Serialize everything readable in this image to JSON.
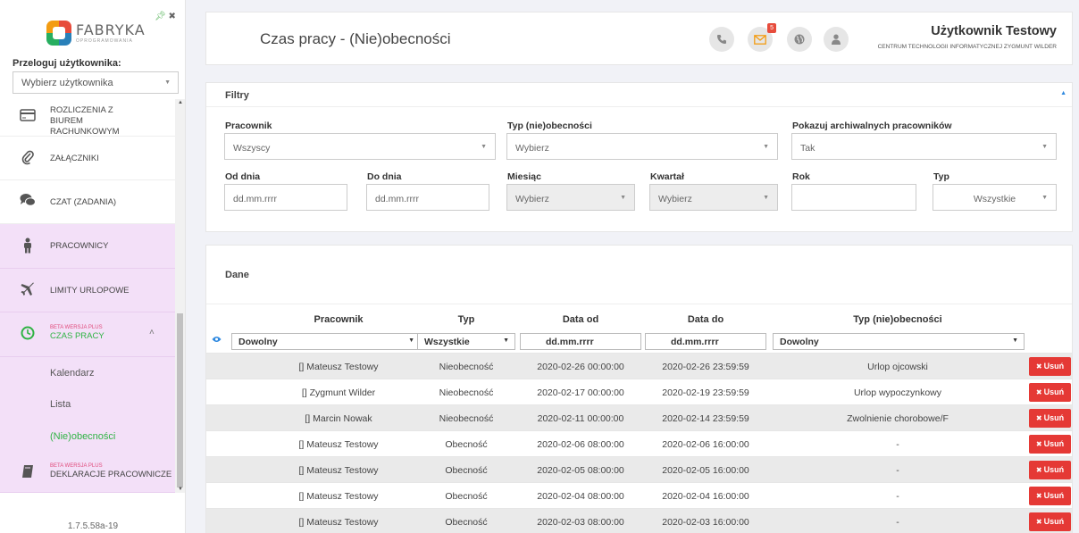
{
  "sidebar": {
    "logo_text": "FABRYKA",
    "logo_sub": "OPROGRAMOWANIA",
    "impersonate_label": "Przeloguj użytkownika:",
    "impersonate_placeholder": "Wybierz użytkownika",
    "menu": [
      {
        "label": "ROZLICZENIA Z BIUREM RACHUNKOWYM",
        "icon": "credit-card-icon"
      },
      {
        "label": "ZAŁĄCZNIKI",
        "icon": "paperclip-icon"
      },
      {
        "label": "CZAT (ZADANIA)",
        "icon": "chat-icon"
      },
      {
        "label": "PRACOWNICY",
        "icon": "person-icon"
      },
      {
        "label": "LIMITY URLOPOWE",
        "icon": "plane-icon"
      },
      {
        "label": "CZAS PRACY",
        "beta": "BETA WERSJA PLUS",
        "icon": "clock-icon"
      },
      {
        "label": "DEKLARACJE PRACOWNICZE",
        "beta": "BETA WERSJA PLUS",
        "icon": "book-icon"
      }
    ],
    "submenu": [
      "Kalendarz",
      "Lista",
      "(Nie)obecności"
    ],
    "version": "1.7.5.58a-19"
  },
  "header": {
    "title": "Czas pracy - (Nie)obecności",
    "mail_count": "5",
    "user_name": "Użytkownik Testowy",
    "user_org": "CENTRUM TECHNOLOGII INFORMATYCZNEJ ZYGMUNT WILDER"
  },
  "filters": {
    "title": "Filtry",
    "pracownik_label": "Pracownik",
    "pracownik_value": "Wszyscy",
    "typ_label": "Typ (nie)obecności",
    "typ_value": "Wybierz",
    "archiwalni_label": "Pokazuj archiwalnych pracowników",
    "archiwalni_value": "Tak",
    "od_label": "Od dnia",
    "od_placeholder": "dd.mm.rrrr",
    "do_label": "Do dnia",
    "do_placeholder": "dd.mm.rrrr",
    "miesiac_label": "Miesiąc",
    "miesiac_value": "Wybierz",
    "kwartal_label": "Kwartał",
    "kwartal_value": "Wybierz",
    "rok_label": "Rok",
    "rok_value": "",
    "typ2_label": "Typ",
    "typ2_value": "Wszystkie"
  },
  "data": {
    "title": "Dane",
    "columns": [
      "Pracownik",
      "Typ",
      "Data od",
      "Data do",
      "Typ (nie)obecności"
    ],
    "column_filters": {
      "pracownik": "Dowolny",
      "typ": "Wszystkie",
      "data_od": "dd.mm.rrrr",
      "data_do": "dd.mm.rrrr",
      "typ_nieobecnosci": "Dowolny"
    },
    "delete_label": "Usuń",
    "rows": [
      {
        "pracownik": "[] Mateusz Testowy",
        "typ": "Nieobecność",
        "od": "2020-02-26 00:00:00",
        "do": "2020-02-26 23:59:59",
        "rodzaj": "Urlop ojcowski"
      },
      {
        "pracownik": "[] Zygmunt Wilder",
        "typ": "Nieobecność",
        "od": "2020-02-17 00:00:00",
        "do": "2020-02-19 23:59:59",
        "rodzaj": "Urlop wypoczynkowy"
      },
      {
        "pracownik": "[] Marcin Nowak",
        "typ": "Nieobecność",
        "od": "2020-02-11 00:00:00",
        "do": "2020-02-14 23:59:59",
        "rodzaj": "Zwolnienie chorobowe/F"
      },
      {
        "pracownik": "[] Mateusz Testowy",
        "typ": "Obecność",
        "od": "2020-02-06 08:00:00",
        "do": "2020-02-06 16:00:00",
        "rodzaj": "-"
      },
      {
        "pracownik": "[] Mateusz Testowy",
        "typ": "Obecność",
        "od": "2020-02-05 08:00:00",
        "do": "2020-02-05 16:00:00",
        "rodzaj": "-"
      },
      {
        "pracownik": "[] Mateusz Testowy",
        "typ": "Obecność",
        "od": "2020-02-04 08:00:00",
        "do": "2020-02-04 16:00:00",
        "rodzaj": "-"
      },
      {
        "pracownik": "[] Mateusz Testowy",
        "typ": "Obecność",
        "od": "2020-02-03 08:00:00",
        "do": "2020-02-03 16:00:00",
        "rodzaj": "-"
      }
    ]
  }
}
